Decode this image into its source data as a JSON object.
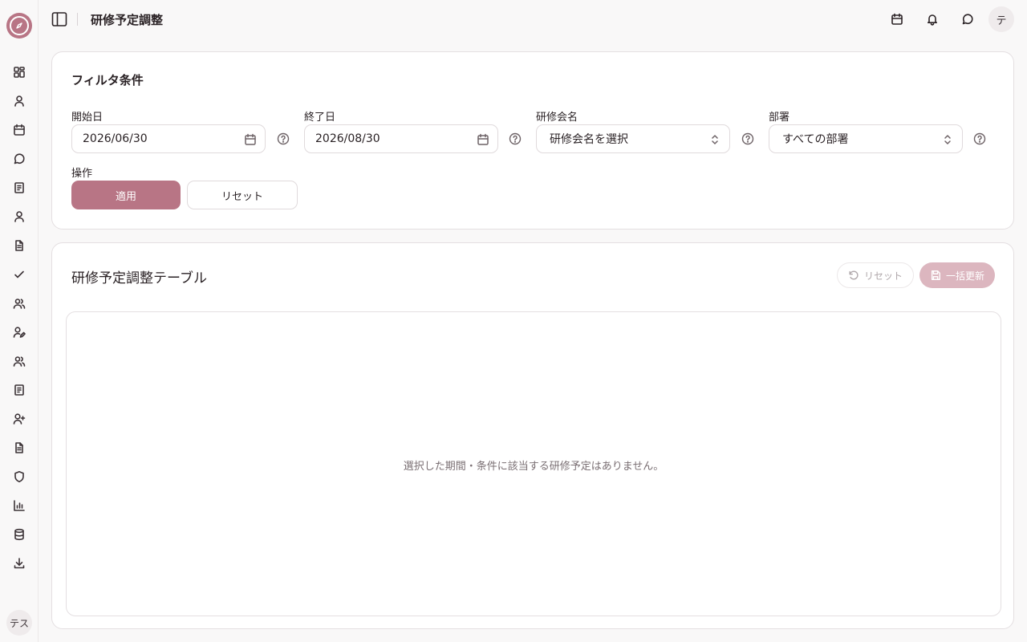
{
  "app": {
    "logo": "compass-logo"
  },
  "sidebar": {
    "items": [
      {
        "name": "dashboard",
        "icon": "grid-icon"
      },
      {
        "name": "profile",
        "icon": "user-icon"
      },
      {
        "name": "calendar",
        "icon": "calendar-icon"
      },
      {
        "name": "messages",
        "icon": "chat-icon"
      },
      {
        "name": "documents",
        "icon": "book-icon"
      },
      {
        "name": "members",
        "icon": "user-icon"
      },
      {
        "name": "reports",
        "icon": "file-icon"
      },
      {
        "name": "tasks",
        "icon": "check-icon"
      },
      {
        "name": "groups",
        "icon": "users-icon"
      },
      {
        "name": "signatures",
        "icon": "user-pen-icon"
      },
      {
        "name": "teams",
        "icon": "users-icon"
      },
      {
        "name": "logs",
        "icon": "book-icon"
      },
      {
        "name": "invite",
        "icon": "user-plus-icon"
      },
      {
        "name": "forms",
        "icon": "file-icon"
      },
      {
        "name": "security",
        "icon": "shield-icon"
      },
      {
        "name": "analytics",
        "icon": "chart-icon"
      },
      {
        "name": "database",
        "icon": "database-icon"
      },
      {
        "name": "download",
        "icon": "download-icon"
      }
    ],
    "user_initials": "テス"
  },
  "header": {
    "title": "研修予定調整",
    "avatar_initial": "テ",
    "icons": [
      "calendar-icon",
      "bell-icon",
      "chat-icon"
    ]
  },
  "filter": {
    "title": "フィルタ条件",
    "start_date_label": "開始日",
    "start_date_value": "2026/06/30",
    "end_date_label": "終了日",
    "end_date_value": "2026/08/30",
    "training_label": "研修会名",
    "training_placeholder": "研修会名を選択",
    "department_label": "部署",
    "department_value": "すべての部署",
    "actions_label": "操作",
    "apply_label": "適用",
    "reset_label": "リセット"
  },
  "table": {
    "title": "研修予定調整テーブル",
    "reset_label": "リセット",
    "bulk_update_label": "一括更新",
    "empty_message": "選択した期間・条件に該当する研修予定はありません。"
  },
  "colors": {
    "accent": "#b87585",
    "accent_disabled": "#dcb6bf",
    "background": "#f9f8f8"
  }
}
